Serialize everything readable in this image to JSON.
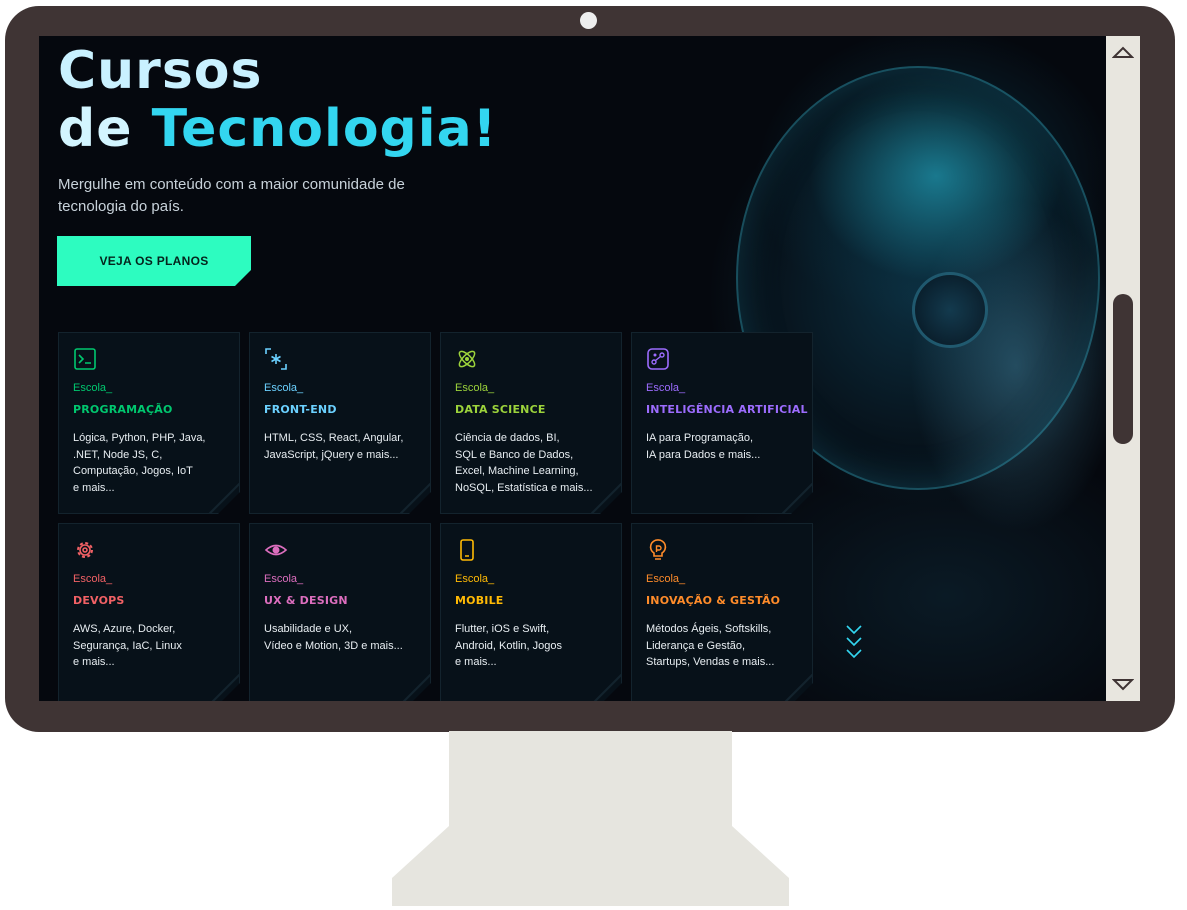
{
  "hero": {
    "title_line1": "Cursos",
    "title_line2a": "de ",
    "title_line2b": "Tecnologia!",
    "subtitle": "Mergulhe em conteúdo com a maior comunidade de tecnologia do país.",
    "cta_label": "VEJA OS PLANOS"
  },
  "colors": {
    "accent": "#2dfcc0",
    "title_highlight": "#33d6f0",
    "background": "#05080e",
    "bezel": "#3f3434"
  },
  "schools": [
    {
      "prefix": "Escola_",
      "name": "PROGRAMAÇÃO",
      "desc": "Lógica, Python, PHP, Java,\n.NET, Node JS, C,\nComputação, Jogos, IoT\ne mais...",
      "color": "#00c86f",
      "icon": "terminal-icon"
    },
    {
      "prefix": "Escola_",
      "name": "FRONT-END",
      "desc": "HTML, CSS, React, Angular,\nJavaScript, jQuery e mais...",
      "color": "#6bd1ff",
      "icon": "asterisk-brackets-icon"
    },
    {
      "prefix": "Escola_",
      "name": "DATA SCIENCE",
      "desc": "Ciência de dados, BI,\nSQL e Banco de Dados,\nExcel, Machine Learning,\nNoSQL, Estatística e mais...",
      "color": "#9cd33b",
      "icon": "atom-icon"
    },
    {
      "prefix": "Escola_",
      "name": "INTELIGÊNCIA ARTIFICIAL",
      "desc": "IA para Programação,\nIA para Dados e mais...",
      "color": "#9c6cfe",
      "icon": "ai-nodes-icon"
    },
    {
      "prefix": "Escola_",
      "name": "DEVOPS",
      "desc": "AWS, Azure, Docker,\nSegurança, IaC, Linux\ne mais...",
      "color": "#f16165",
      "icon": "gear-icon"
    },
    {
      "prefix": "Escola_",
      "name": "UX & DESIGN",
      "desc": "Usabilidade e UX,\nVídeo e Motion, 3D e mais...",
      "color": "#dc6ebe",
      "icon": "eye-icon"
    },
    {
      "prefix": "Escola_",
      "name": "MOBILE",
      "desc": "Flutter, iOS e Swift,\nAndroid, Kotlin, Jogos\ne mais...",
      "color": "#ffba05",
      "icon": "smartphone-icon"
    },
    {
      "prefix": "Escola_",
      "name": "INOVAÇÃO & GESTÃO",
      "desc": "Métodos Ágeis, Softskills,\nLiderança e Gestão,\nStartups, Vendas e mais...",
      "color": "#ff8c2a",
      "icon": "lightbulb-icon"
    }
  ]
}
